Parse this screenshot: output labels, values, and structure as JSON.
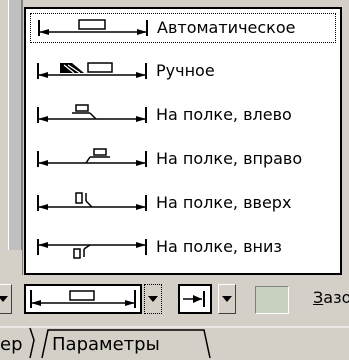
{
  "menu": {
    "items": [
      {
        "label": "Автоматическое",
        "icon": "leader-auto-icon",
        "selected": true
      },
      {
        "label": "Ручное",
        "icon": "leader-manual-icon",
        "selected": false
      },
      {
        "label": "На полке, влево",
        "icon": "leader-shelf-left-icon",
        "selected": false
      },
      {
        "label": "На полке, вправо",
        "icon": "leader-shelf-right-icon",
        "selected": false
      },
      {
        "label": "На полке, вверх",
        "icon": "leader-shelf-up-icon",
        "selected": false
      },
      {
        "label": "На полке, вниз",
        "icon": "leader-shelf-down-icon",
        "selected": false
      }
    ]
  },
  "toolbar": {
    "label_underlined": "З",
    "label_rest": "азо"
  },
  "tabs": {
    "prev": "ер",
    "active": "Параметры"
  }
}
